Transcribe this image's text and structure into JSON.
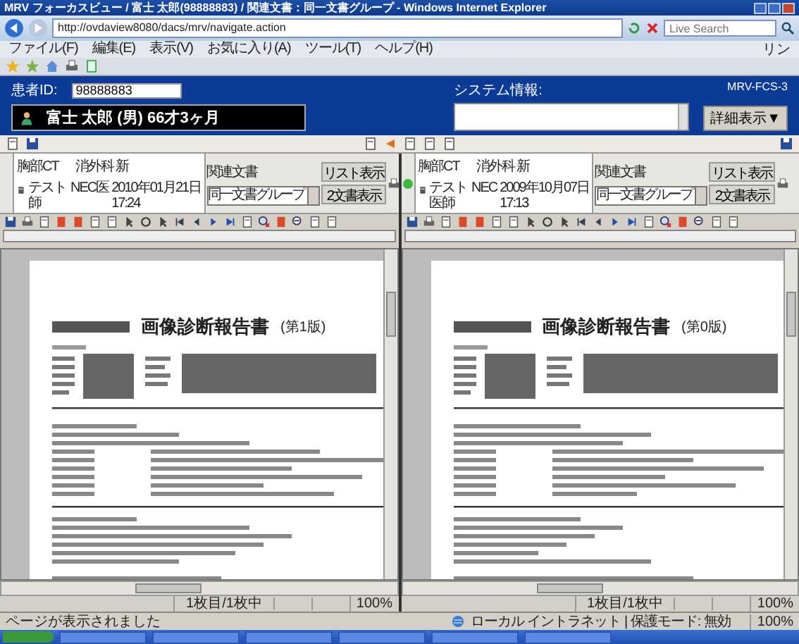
{
  "window": {
    "title": "MRV フォーカスビュー / 富士 太郎(98888883) / 関連文書：同一文書グループ - Windows Internet Explorer"
  },
  "address_bar": {
    "url": "http://ovdaview8080/dacs/mrv/navigate.action",
    "search_placeholder": "Live Search"
  },
  "menu": [
    "ファイル(F)",
    "編集(E)",
    "表示(V)",
    "お気に入り(A)",
    "ツール(T)",
    "ヘルプ(H)"
  ],
  "menu_overflow": "リン",
  "header": {
    "patient_id_label": "患者ID:",
    "patient_id": "98888883",
    "patient_name": "富士 太郎 (男) 66才3ヶ月",
    "system_info_label": "システム情報:",
    "system_code": "MRV-FCS-3",
    "detail_button": "詳細表示▼"
  },
  "panes": [
    {
      "online": false,
      "exam": "胸部CT",
      "department": "消外科 新",
      "author": "テスト師",
      "hospital": "NEC医",
      "date": "2010年01月21日",
      "time": "17:24",
      "related_label": "関連文書",
      "related_value": "同一文書グループ",
      "list_button": "リスト表示",
      "dual_button": "2文書表示",
      "report_title": "画像診断報告書",
      "report_version": "(第1版)",
      "page_info": "1枚目/1枚中",
      "zoom": "100%"
    },
    {
      "online": true,
      "exam": "胸部CT",
      "department": "消外科 新",
      "author": "テスト医師",
      "hospital": "NEC",
      "date": "2009年10月07日",
      "time": "17:13",
      "related_label": "関連文書",
      "related_value": "同一文書グループ",
      "list_button": "リスト表示",
      "dual_button": "2文書表示",
      "report_title": "画像診断報告書",
      "report_version": "(第0版)",
      "page_info": "1枚目/1枚中",
      "zoom": "100%"
    }
  ],
  "status_bar": {
    "text": "ページが表示されました",
    "zone": "ローカル イントラネット | 保護モード: 無効",
    "zoom": "100%"
  }
}
